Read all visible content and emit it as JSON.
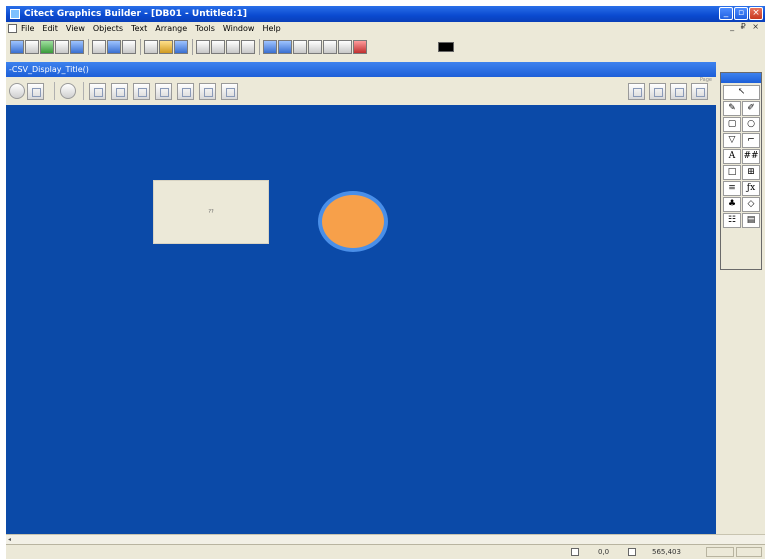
{
  "window": {
    "title": "Citect Graphics Builder - [DB01 - Untitled:1]"
  },
  "menubar": {
    "items": [
      "File",
      "Edit",
      "View",
      "Objects",
      "Text",
      "Arrange",
      "Tools",
      "Window",
      "Help"
    ],
    "mdi_controls": "_ ₽ ×"
  },
  "child": {
    "title": "-CSV_Display_Title()",
    "search_hint": "Page"
  },
  "canvas": {
    "button_label": "??",
    "colors": {
      "background": "#0b4aa8",
      "circle_fill": "#f7a04a",
      "circle_border": "#4a8fe8",
      "button_fill": "#ece9d8"
    }
  },
  "statusbar": {
    "coords": "0,0",
    "size": "565,403"
  },
  "palette": {
    "tools": [
      {
        "icon": "pointer-icon",
        "glyph": "↖"
      },
      {
        "icon": "pencil-icon",
        "glyph": "✎"
      },
      {
        "icon": "pen-icon",
        "glyph": "✐"
      },
      {
        "icon": "rectangle-icon",
        "glyph": "▢"
      },
      {
        "icon": "ellipse-icon",
        "glyph": "○"
      },
      {
        "icon": "polygon-icon",
        "glyph": "▽"
      },
      {
        "icon": "pipe-icon",
        "glyph": "⌐"
      },
      {
        "icon": "text-icon",
        "glyph": "A"
      },
      {
        "icon": "number-icon",
        "glyph": "##"
      },
      {
        "icon": "button-icon",
        "glyph": "□"
      },
      {
        "icon": "symbol-icon",
        "glyph": "⊞"
      },
      {
        "icon": "trend-icon",
        "glyph": "≡"
      },
      {
        "icon": "cicode-icon",
        "glyph": "ƒx"
      },
      {
        "icon": "library-icon",
        "glyph": "♣"
      },
      {
        "icon": "genie-icon",
        "glyph": "◇"
      },
      {
        "icon": "active-x-icon",
        "glyph": "☷"
      },
      {
        "icon": "database-icon",
        "glyph": "▤"
      }
    ]
  }
}
